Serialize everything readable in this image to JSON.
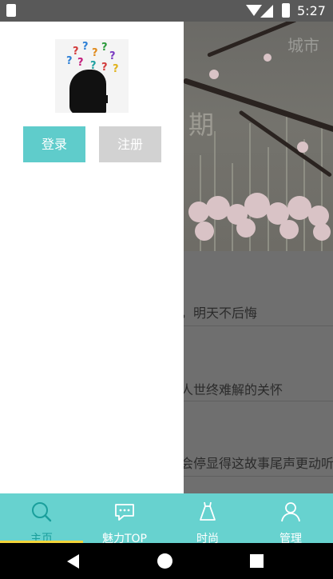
{
  "status_bar": {
    "time": "5:27"
  },
  "background": {
    "city_label": "城市",
    "period_label": "期",
    "list_items": [
      "，明天不后悔",
      "人世终难解的关怀",
      "会停显得这故事尾声更动听"
    ]
  },
  "drawer": {
    "login_label": "登录",
    "register_label": "注册"
  },
  "tabs": [
    {
      "label": "主页",
      "icon": "search-icon",
      "active": true
    },
    {
      "label": "魅力TOP",
      "icon": "chat-bubble-icon",
      "active": false
    },
    {
      "label": "时尚",
      "icon": "dress-icon",
      "active": false
    },
    {
      "label": "管理",
      "icon": "person-icon",
      "active": false
    }
  ],
  "colors": {
    "accent": "#67d2cf",
    "login_button": "#5fcccb",
    "register_button": "#d2d2d2",
    "tab_indicator": "#f2d43a"
  }
}
